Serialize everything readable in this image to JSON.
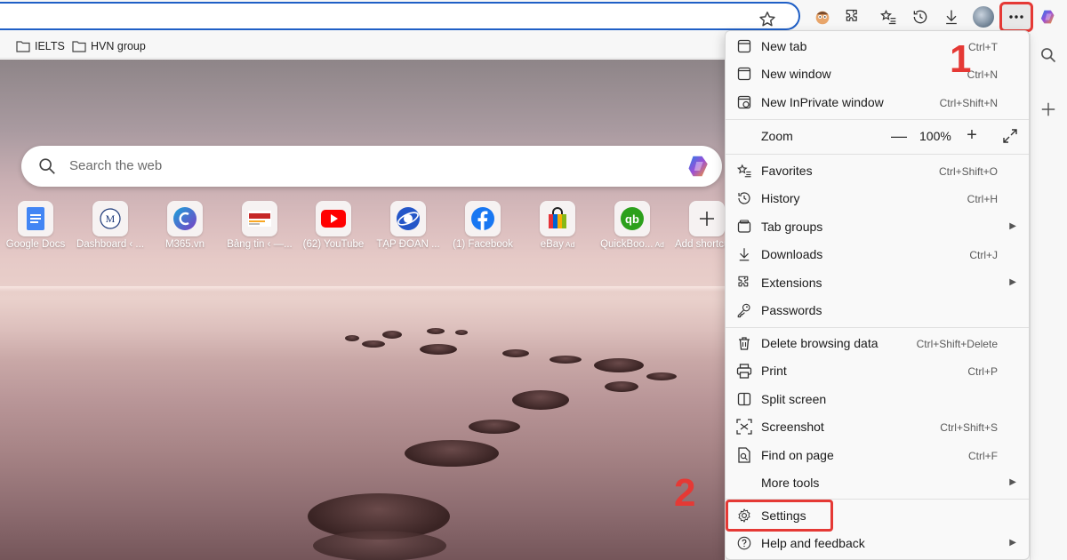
{
  "favorites_bar": {
    "items": [
      {
        "label": "IELTS",
        "icon": "folder-icon"
      },
      {
        "label": "HVN group",
        "icon": "folder-icon"
      }
    ]
  },
  "search": {
    "placeholder": "Search the web"
  },
  "shortcuts": [
    {
      "label": "Google Docs",
      "icon": "google-docs-icon",
      "color": "#4285f4",
      "ad": ""
    },
    {
      "label": "Dashboard ‹ ...",
      "icon": "dashboard-icon",
      "color": "#1e3a7a",
      "ad": ""
    },
    {
      "label": "M365.vn",
      "icon": "m365-icon",
      "color": "#1aa3d9",
      "ad": ""
    },
    {
      "label": "Bảng tin ‹ —...",
      "icon": "bang-tin-icon",
      "color": "#c62828",
      "ad": ""
    },
    {
      "label": "(62) YouTube",
      "icon": "youtube-icon",
      "color": "#ff0000",
      "ad": ""
    },
    {
      "label": "TẬP ĐOÀN ...",
      "icon": "tap-doan-icon",
      "color": "#2456c8",
      "ad": ""
    },
    {
      "label": "(1) Facebook",
      "icon": "facebook-icon",
      "color": "#1877f2",
      "ad": ""
    },
    {
      "label": "eBay",
      "icon": "ebay-icon",
      "color": "#e53238",
      "ad": "Ad"
    },
    {
      "label": "QuickBoo...",
      "icon": "quickbooks-icon",
      "color": "#2ca01c",
      "ad": "Ad"
    },
    {
      "label": "Add shortcut",
      "icon": "plus-icon",
      "color": "#333333",
      "ad": ""
    }
  ],
  "menu": {
    "new_tab": {
      "label": "New tab",
      "shortcut": "Ctrl+T"
    },
    "new_window": {
      "label": "New window",
      "shortcut": "Ctrl+N"
    },
    "new_inprivate": {
      "label": "New InPrivate window",
      "shortcut": "Ctrl+Shift+N"
    },
    "zoom": {
      "label": "Zoom",
      "value": "100%",
      "minus": "—",
      "plus": "+"
    },
    "favorites": {
      "label": "Favorites",
      "shortcut": "Ctrl+Shift+O"
    },
    "history": {
      "label": "History",
      "shortcut": "Ctrl+H"
    },
    "tab_groups": {
      "label": "Tab groups",
      "shortcut": ""
    },
    "downloads": {
      "label": "Downloads",
      "shortcut": "Ctrl+J"
    },
    "extensions": {
      "label": "Extensions",
      "shortcut": ""
    },
    "passwords": {
      "label": "Passwords",
      "shortcut": ""
    },
    "delete_browsing": {
      "label": "Delete browsing data",
      "shortcut": "Ctrl+Shift+Delete"
    },
    "print": {
      "label": "Print",
      "shortcut": "Ctrl+P"
    },
    "split_screen": {
      "label": "Split screen",
      "shortcut": ""
    },
    "screenshot": {
      "label": "Screenshot",
      "shortcut": "Ctrl+Shift+S"
    },
    "find_on_page": {
      "label": "Find on page",
      "shortcut": "Ctrl+F"
    },
    "more_tools": {
      "label": "More tools",
      "shortcut": ""
    },
    "settings": {
      "label": "Settings",
      "shortcut": ""
    },
    "help_feedback": {
      "label": "Help and feedback",
      "shortcut": ""
    }
  },
  "annotations": {
    "step1": "1",
    "step2": "2",
    "highlight_color": "#e53935"
  },
  "colors": {
    "accent": "#1f5fc6",
    "menu_bg": "#f9f9f9",
    "toolbar_bg": "#f7f7f7"
  }
}
